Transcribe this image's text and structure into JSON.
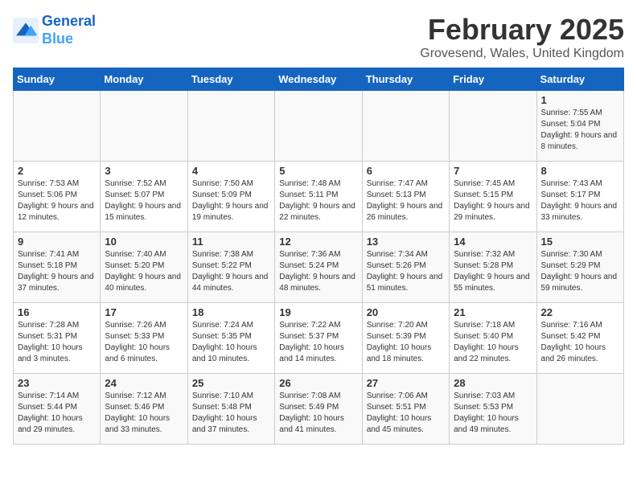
{
  "header": {
    "logo_line1": "General",
    "logo_line2": "Blue",
    "month": "February 2025",
    "location": "Grovesend, Wales, United Kingdom"
  },
  "days_of_week": [
    "Sunday",
    "Monday",
    "Tuesday",
    "Wednesday",
    "Thursday",
    "Friday",
    "Saturday"
  ],
  "weeks": [
    [
      {
        "day": "",
        "info": ""
      },
      {
        "day": "",
        "info": ""
      },
      {
        "day": "",
        "info": ""
      },
      {
        "day": "",
        "info": ""
      },
      {
        "day": "",
        "info": ""
      },
      {
        "day": "",
        "info": ""
      },
      {
        "day": "1",
        "info": "Sunrise: 7:55 AM\nSunset: 5:04 PM\nDaylight: 9 hours and 8 minutes."
      }
    ],
    [
      {
        "day": "2",
        "info": "Sunrise: 7:53 AM\nSunset: 5:06 PM\nDaylight: 9 hours and 12 minutes."
      },
      {
        "day": "3",
        "info": "Sunrise: 7:52 AM\nSunset: 5:07 PM\nDaylight: 9 hours and 15 minutes."
      },
      {
        "day": "4",
        "info": "Sunrise: 7:50 AM\nSunset: 5:09 PM\nDaylight: 9 hours and 19 minutes."
      },
      {
        "day": "5",
        "info": "Sunrise: 7:48 AM\nSunset: 5:11 PM\nDaylight: 9 hours and 22 minutes."
      },
      {
        "day": "6",
        "info": "Sunrise: 7:47 AM\nSunset: 5:13 PM\nDaylight: 9 hours and 26 minutes."
      },
      {
        "day": "7",
        "info": "Sunrise: 7:45 AM\nSunset: 5:15 PM\nDaylight: 9 hours and 29 minutes."
      },
      {
        "day": "8",
        "info": "Sunrise: 7:43 AM\nSunset: 5:17 PM\nDaylight: 9 hours and 33 minutes."
      }
    ],
    [
      {
        "day": "9",
        "info": "Sunrise: 7:41 AM\nSunset: 5:18 PM\nDaylight: 9 hours and 37 minutes."
      },
      {
        "day": "10",
        "info": "Sunrise: 7:40 AM\nSunset: 5:20 PM\nDaylight: 9 hours and 40 minutes."
      },
      {
        "day": "11",
        "info": "Sunrise: 7:38 AM\nSunset: 5:22 PM\nDaylight: 9 hours and 44 minutes."
      },
      {
        "day": "12",
        "info": "Sunrise: 7:36 AM\nSunset: 5:24 PM\nDaylight: 9 hours and 48 minutes."
      },
      {
        "day": "13",
        "info": "Sunrise: 7:34 AM\nSunset: 5:26 PM\nDaylight: 9 hours and 51 minutes."
      },
      {
        "day": "14",
        "info": "Sunrise: 7:32 AM\nSunset: 5:28 PM\nDaylight: 9 hours and 55 minutes."
      },
      {
        "day": "15",
        "info": "Sunrise: 7:30 AM\nSunset: 5:29 PM\nDaylight: 9 hours and 59 minutes."
      }
    ],
    [
      {
        "day": "16",
        "info": "Sunrise: 7:28 AM\nSunset: 5:31 PM\nDaylight: 10 hours and 3 minutes."
      },
      {
        "day": "17",
        "info": "Sunrise: 7:26 AM\nSunset: 5:33 PM\nDaylight: 10 hours and 6 minutes."
      },
      {
        "day": "18",
        "info": "Sunrise: 7:24 AM\nSunset: 5:35 PM\nDaylight: 10 hours and 10 minutes."
      },
      {
        "day": "19",
        "info": "Sunrise: 7:22 AM\nSunset: 5:37 PM\nDaylight: 10 hours and 14 minutes."
      },
      {
        "day": "20",
        "info": "Sunrise: 7:20 AM\nSunset: 5:39 PM\nDaylight: 10 hours and 18 minutes."
      },
      {
        "day": "21",
        "info": "Sunrise: 7:18 AM\nSunset: 5:40 PM\nDaylight: 10 hours and 22 minutes."
      },
      {
        "day": "22",
        "info": "Sunrise: 7:16 AM\nSunset: 5:42 PM\nDaylight: 10 hours and 26 minutes."
      }
    ],
    [
      {
        "day": "23",
        "info": "Sunrise: 7:14 AM\nSunset: 5:44 PM\nDaylight: 10 hours and 29 minutes."
      },
      {
        "day": "24",
        "info": "Sunrise: 7:12 AM\nSunset: 5:46 PM\nDaylight: 10 hours and 33 minutes."
      },
      {
        "day": "25",
        "info": "Sunrise: 7:10 AM\nSunset: 5:48 PM\nDaylight: 10 hours and 37 minutes."
      },
      {
        "day": "26",
        "info": "Sunrise: 7:08 AM\nSunset: 5:49 PM\nDaylight: 10 hours and 41 minutes."
      },
      {
        "day": "27",
        "info": "Sunrise: 7:06 AM\nSunset: 5:51 PM\nDaylight: 10 hours and 45 minutes."
      },
      {
        "day": "28",
        "info": "Sunrise: 7:03 AM\nSunset: 5:53 PM\nDaylight: 10 hours and 49 minutes."
      },
      {
        "day": "",
        "info": ""
      }
    ]
  ]
}
